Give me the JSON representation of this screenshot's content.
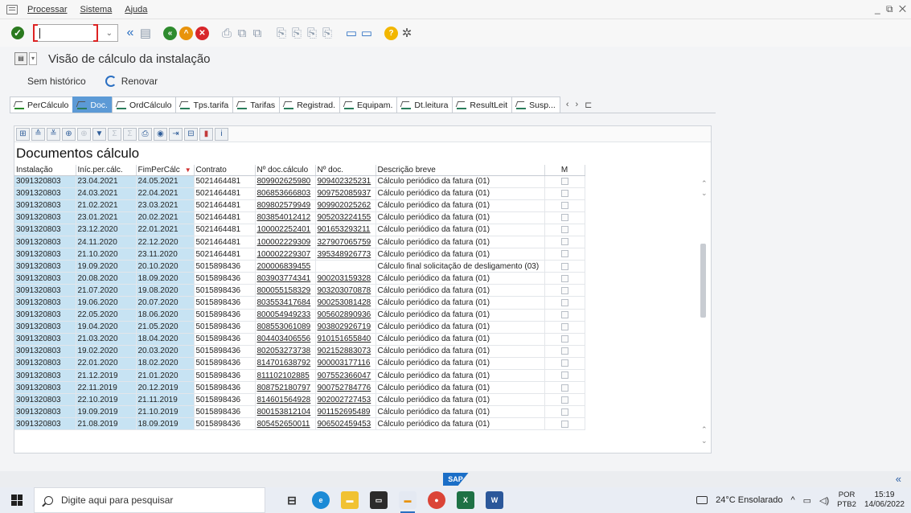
{
  "menubar": {
    "items": [
      "Processar",
      "Sistema",
      "Ajuda"
    ],
    "window_controls": "_ ⧉ ✕"
  },
  "toolbar": {
    "command_field_value": "",
    "icons": [
      "enter-icon",
      "command-field",
      "back-icon",
      "save-icon",
      "back-green-icon",
      "exit-icon",
      "cancel-icon",
      "print-icon",
      "find-icon",
      "find-next-icon",
      "first-page-icon",
      "prev-page-icon",
      "next-page-icon",
      "last-page-icon",
      "new-session-icon",
      "shortcut-icon",
      "help-icon",
      "settings-icon"
    ]
  },
  "title": {
    "text": "Visão de cálculo da instalação"
  },
  "actions": {
    "history_label": "Sem histórico",
    "refresh_label": "Renovar"
  },
  "tabs": [
    {
      "label": "PerCálculo",
      "active": false
    },
    {
      "label": "Doc.",
      "active": true
    },
    {
      "label": "OrdCálculo",
      "active": false
    },
    {
      "label": "Tps.tarifa",
      "active": false
    },
    {
      "label": "Tarifas",
      "active": false
    },
    {
      "label": "Registrad.",
      "active": false
    },
    {
      "label": "Equipam.",
      "active": false
    },
    {
      "label": "Dt.leitura",
      "active": false
    },
    {
      "label": "ResultLeit",
      "active": false
    },
    {
      "label": "Susp...",
      "active": false
    }
  ],
  "alv": {
    "title": "Documentos cálculo",
    "columns": [
      "Instalação",
      "Iníc.per.cálc.",
      "FimPerCálc",
      "Contrato",
      "Nº doc.cálculo",
      "Nº doc.",
      "Descrição breve",
      "M"
    ],
    "rows": [
      [
        "3091320803",
        "23.04.2021",
        "24.05.2021",
        "5021464481",
        "809902625980",
        "909402325231",
        "Cálculo periódico da fatura (01)"
      ],
      [
        "3091320803",
        "24.03.2021",
        "22.04.2021",
        "5021464481",
        "806853666803",
        "909752085937",
        "Cálculo periódico da fatura (01)"
      ],
      [
        "3091320803",
        "21.02.2021",
        "23.03.2021",
        "5021464481",
        "809802579949",
        "909902025262",
        "Cálculo periódico da fatura (01)"
      ],
      [
        "3091320803",
        "23.01.2021",
        "20.02.2021",
        "5021464481",
        "803854012412",
        "905203224155",
        "Cálculo periódico da fatura (01)"
      ],
      [
        "3091320803",
        "23.12.2020",
        "22.01.2021",
        "5021464481",
        "100002252401",
        "901653293211",
        "Cálculo periódico da fatura (01)"
      ],
      [
        "3091320803",
        "24.11.2020",
        "22.12.2020",
        "5021464481",
        "100002229309",
        "327907065759",
        "Cálculo periódico da fatura (01)"
      ],
      [
        "3091320803",
        "21.10.2020",
        "23.11.2020",
        "5021464481",
        "100002229307",
        "395348926773",
        "Cálculo periódico da fatura (01)"
      ],
      [
        "3091320803",
        "19.09.2020",
        "20.10.2020",
        "5015898436",
        "200006839455",
        "",
        "Cálculo final solicitação de desligamento (03)"
      ],
      [
        "3091320803",
        "20.08.2020",
        "18.09.2020",
        "5015898436",
        "803903774341",
        "900203159328",
        "Cálculo periódico da fatura (01)"
      ],
      [
        "3091320803",
        "21.07.2020",
        "19.08.2020",
        "5015898436",
        "800055158329",
        "903203070878",
        "Cálculo periódico da fatura (01)"
      ],
      [
        "3091320803",
        "19.06.2020",
        "20.07.2020",
        "5015898436",
        "803553417684",
        "900253081428",
        "Cálculo periódico da fatura (01)"
      ],
      [
        "3091320803",
        "22.05.2020",
        "18.06.2020",
        "5015898436",
        "800054949233",
        "905602890936",
        "Cálculo periódico da fatura (01)"
      ],
      [
        "3091320803",
        "19.04.2020",
        "21.05.2020",
        "5015898436",
        "808553061089",
        "903802926719",
        "Cálculo periódico da fatura (01)"
      ],
      [
        "3091320803",
        "21.03.2020",
        "18.04.2020",
        "5015898436",
        "804403406556",
        "910151655840",
        "Cálculo periódico da fatura (01)"
      ],
      [
        "3091320803",
        "19.02.2020",
        "20.03.2020",
        "5015898436",
        "802053273738",
        "902152883073",
        "Cálculo periódico da fatura (01)"
      ],
      [
        "3091320803",
        "22.01.2020",
        "18.02.2020",
        "5015898436",
        "814701638792",
        "900003177116",
        "Cálculo periódico da fatura (01)"
      ],
      [
        "3091320803",
        "21.12.2019",
        "21.01.2020",
        "5015898436",
        "811102102885",
        "907552366047",
        "Cálculo periódico da fatura (01)"
      ],
      [
        "3091320803",
        "22.11.2019",
        "20.12.2019",
        "5015898436",
        "808752180797",
        "900752784776",
        "Cálculo periódico da fatura (01)"
      ],
      [
        "3091320803",
        "22.10.2019",
        "21.11.2019",
        "5015898436",
        "814601564928",
        "902002727453",
        "Cálculo periódico da fatura (01)"
      ],
      [
        "3091320803",
        "19.09.2019",
        "21.10.2019",
        "5015898436",
        "800153812104",
        "901152695489",
        "Cálculo periódico da fatura (01)"
      ],
      [
        "3091320803",
        "21.08.2019",
        "18.09.2019",
        "5015898436",
        "805452650011",
        "906502459453",
        "Cálculo periódico da fatura (01)"
      ]
    ]
  },
  "status": {
    "logo": "SAP",
    "collapse_icon": "«"
  },
  "taskbar": {
    "search_placeholder": "Digite aqui para pesquisar",
    "weather": "24°C Ensolarado",
    "lang_top": "POR",
    "lang_bottom": "PTB2",
    "time": "15:19",
    "date": "14/06/2022"
  },
  "colors": {
    "active_tab": "#5c9ad6",
    "key_column": "#c7e3f3",
    "ok_green": "#2b7a1f"
  }
}
